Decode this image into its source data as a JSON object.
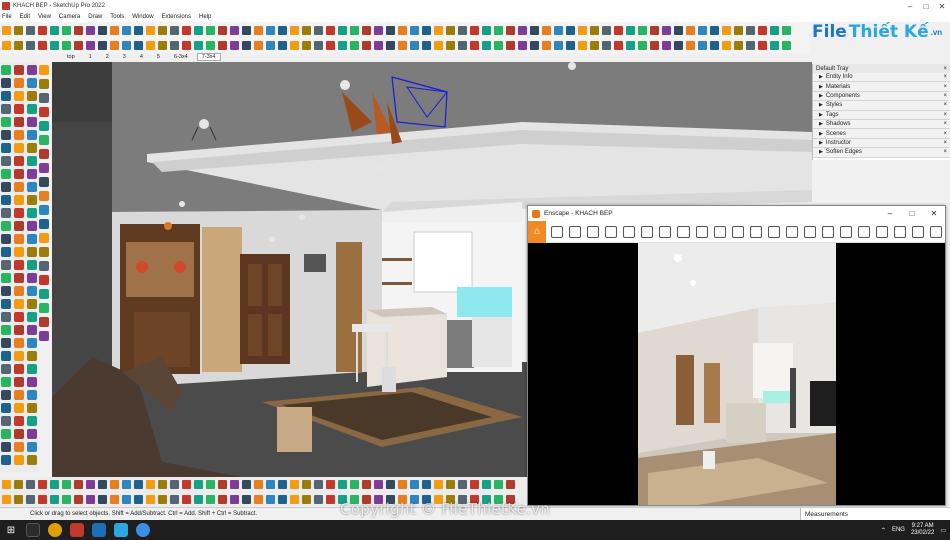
{
  "window": {
    "title": "KHACH BEP - SketchUp Pro 2022"
  },
  "menu": [
    "File",
    "Edit",
    "View",
    "Camera",
    "Draw",
    "Tools",
    "Window",
    "Extensions",
    "Help"
  ],
  "logo": {
    "part1": "File",
    "part2": "Thiết Kế",
    "domain": ".vn"
  },
  "scenes": [
    "top",
    "1",
    "2",
    "3",
    "4",
    "5",
    "6-3x4",
    "7-3x4"
  ],
  "active_scene": "7-3x4",
  "tray": {
    "title": "Default Tray",
    "items": [
      "Entity Info",
      "Materials",
      "Components",
      "Styles",
      "Tags",
      "Shadows",
      "Scenes",
      "Instructor",
      "Soften Edges"
    ]
  },
  "enscape": {
    "title": "Enscape - KHACH BEP"
  },
  "status": {
    "message": "Click or drag to select objects. Shift = Add/Subtract. Ctrl = Add. Shift + Ctrl = Subtract.",
    "measurements_label": "Measurements"
  },
  "watermark": "Copyright © FileThietKe.vn",
  "taskbar": {
    "language": "ENG",
    "time": "9:27 AM",
    "date": "23/02/22"
  },
  "colors": {
    "enscape_accent": "#f08a24",
    "logo_blue": "#1b77c4",
    "taskbar": "#1e1e1e"
  }
}
